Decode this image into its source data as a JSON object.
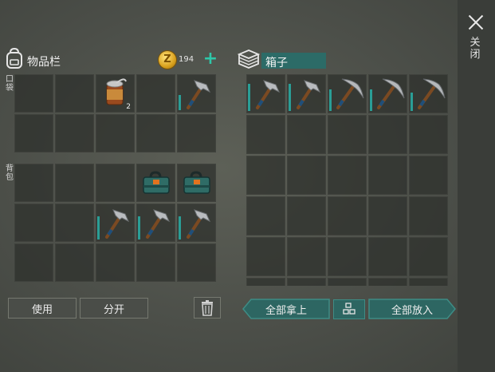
{
  "window": {
    "close_label": "关闭"
  },
  "inventory": {
    "title": "物品栏",
    "coins": "194",
    "coin_symbol": "Z",
    "pocket_label": "口袋",
    "backpack_label": "背包",
    "pocket_slots": [
      {
        "item": null
      },
      {
        "item": null
      },
      {
        "item": "canned-food",
        "qty": "2"
      },
      {
        "item": null
      },
      {
        "item": "hammer",
        "durability": 0.45
      },
      {
        "item": null
      },
      {
        "item": null
      },
      {
        "item": null
      },
      {
        "item": null
      },
      {
        "item": null
      }
    ],
    "backpack_slots": [
      {
        "item": null
      },
      {
        "item": null
      },
      {
        "item": null
      },
      {
        "item": "toolbox"
      },
      {
        "item": "toolbox"
      },
      {
        "item": null
      },
      {
        "item": null
      },
      {
        "item": "hammer",
        "durability": 0.7
      },
      {
        "item": "hammer",
        "durability": 0.7
      },
      {
        "item": "hammer",
        "durability": 0.7
      },
      {
        "item": null
      },
      {
        "item": null
      },
      {
        "item": null
      },
      {
        "item": null
      },
      {
        "item": null
      }
    ],
    "use_button": "使用",
    "split_button": "分开",
    "trash_icon": "trash-icon"
  },
  "box": {
    "title": "箱子",
    "slots": [
      {
        "item": "hammer",
        "durability": 0.8
      },
      {
        "item": "hammer",
        "durability": 0.8
      },
      {
        "item": "pickaxe",
        "durability": 0.65
      },
      {
        "item": "pickaxe",
        "durability": 0.65
      },
      {
        "item": "pickaxe",
        "durability": 0.55
      },
      {
        "item": null
      },
      {
        "item": null
      },
      {
        "item": null
      },
      {
        "item": null
      },
      {
        "item": null
      },
      {
        "item": null
      },
      {
        "item": null
      },
      {
        "item": null
      },
      {
        "item": null
      },
      {
        "item": null
      },
      {
        "item": null
      },
      {
        "item": null
      },
      {
        "item": null
      },
      {
        "item": null
      },
      {
        "item": null
      },
      {
        "item": null
      },
      {
        "item": null
      },
      {
        "item": null
      },
      {
        "item": null
      },
      {
        "item": null
      },
      {
        "item": null
      },
      {
        "item": null
      },
      {
        "item": null
      },
      {
        "item": null
      },
      {
        "item": null
      }
    ],
    "take_all_button": "全部拿上",
    "put_all_button": "全部放入",
    "sort_icon": "sort-grid-icon"
  },
  "colors": {
    "accent": "#2ec7a9",
    "durability": "#2a9e96",
    "button_teal": "#2d6662"
  }
}
